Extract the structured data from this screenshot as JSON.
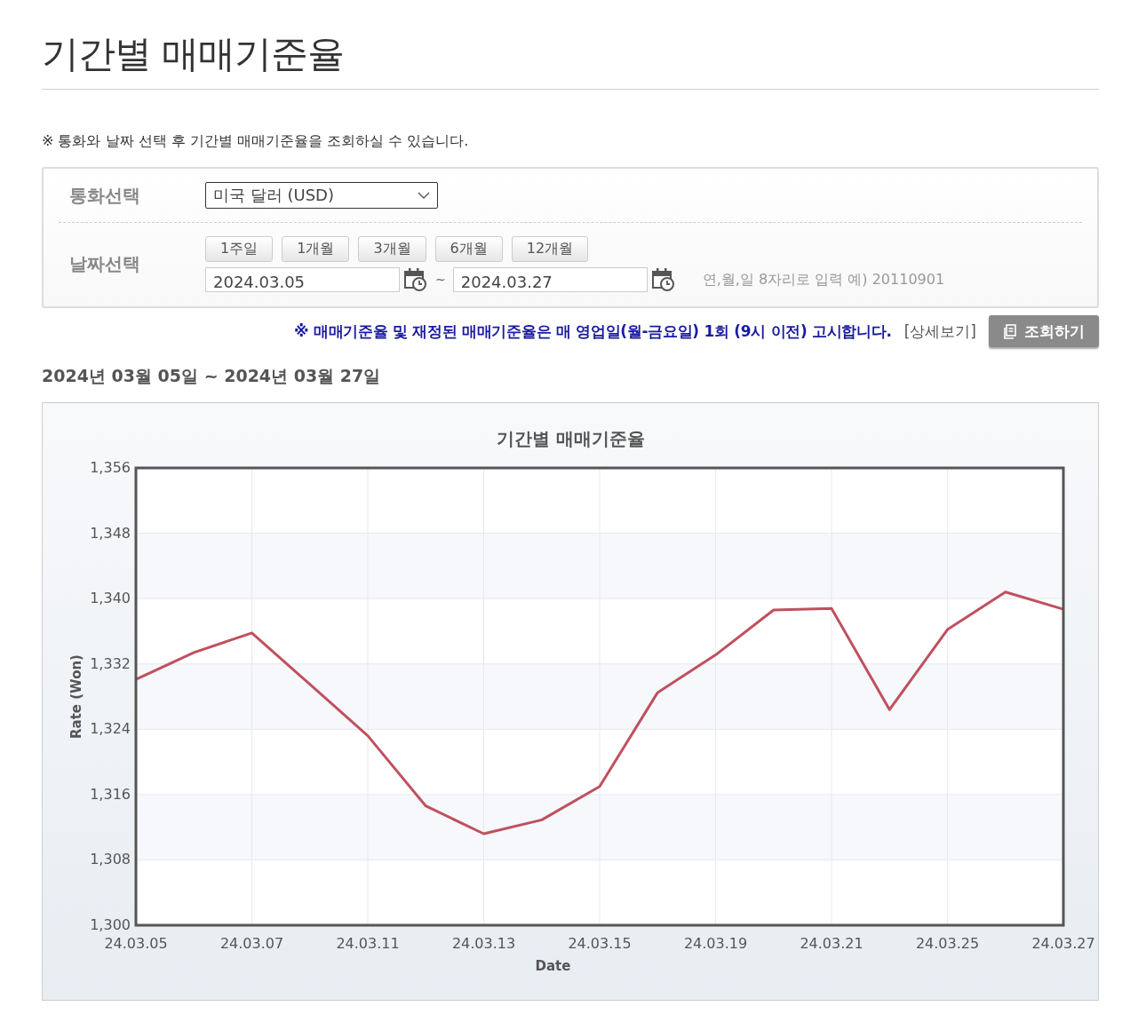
{
  "page_title": "기간별 매매기준율",
  "notice": "※ 통화와 날짜 선택 후 기간별 매매기준율을 조회하실 수 있습니다.",
  "form": {
    "currency_label": "통화선택",
    "currency_value": "미국 달러 (USD)",
    "date_label": "날짜선택",
    "periods": [
      "1주일",
      "1개월",
      "3개월",
      "6개월",
      "12개월"
    ],
    "start_date": "2024.03.05",
    "separator": "~",
    "end_date": "2024.03.27",
    "hint": "연,월,일 8자리로 입력 예) 20110901"
  },
  "info": "※ 매매기준율 및 재정된 매매기준율은 매 영업일(월-금요일) 1회 (9시 이전) 고시합니다.",
  "detail_link": "[상세보기]",
  "search_button": "조회하기",
  "range": "**2024**년 **03**월 **05**일 ~ **2024**년 **03**월 **27**일",
  "chart_data": {
    "type": "line",
    "title": "기간별 매매기준율",
    "xlabel": "Date",
    "ylabel": "Rate (Won)",
    "categories": [
      "24.03.05",
      null,
      "24.03.07",
      null,
      "24.03.11",
      null,
      "24.03.13",
      null,
      "24.03.15",
      null,
      "24.03.19",
      null,
      "24.03.21",
      null,
      "24.03.25",
      null,
      "24.03.27"
    ],
    "series": [
      {
        "color": "#c0505f",
        "values": [
          1330.1,
          1333.4,
          1335.8,
          1329.5,
          1323.2,
          1314.6,
          1311.2,
          1312.9,
          1317.0,
          1328.5,
          1333.1,
          1338.6,
          1338.8,
          1326.4,
          1336.2,
          1340.8,
          1338.7
        ]
      }
    ],
    "ylim": [
      1300,
      1356
    ],
    "grid": true,
    "yticks": [
      {
        "value": 1300,
        "label": "1,300"
      },
      {
        "value": 1308,
        "label": "1,308"
      },
      {
        "value": 1316,
        "label": "1,316"
      },
      {
        "value": 1324,
        "label": "1,324"
      },
      {
        "value": 1332,
        "label": "1,332"
      },
      {
        "value": 1340,
        "label": "1,340"
      },
      {
        "value": 1348,
        "label": "1,348"
      },
      {
        "value": 1356,
        "label": "1,356"
      }
    ]
  }
}
